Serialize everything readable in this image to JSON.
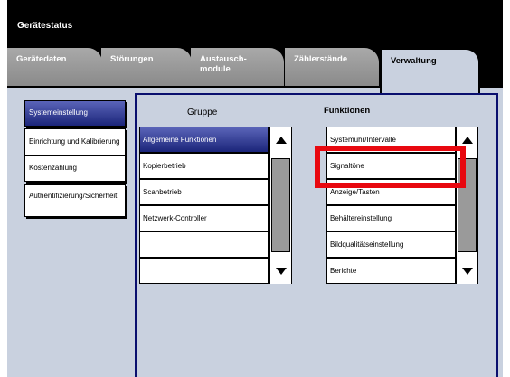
{
  "header": {
    "title": "Gerätestatus"
  },
  "tabs": [
    {
      "label": "Gerätedaten",
      "active": false
    },
    {
      "label": "Störungen",
      "active": false
    },
    {
      "label": "Austausch-\nmodule",
      "active": false
    },
    {
      "label": "Zählerstände",
      "active": false
    },
    {
      "label": "Verwaltung",
      "active": true
    }
  ],
  "sidebar": {
    "items": [
      {
        "label": "Systemeinstellung",
        "active": true
      },
      {
        "label": "Einrichtung und Kalibrierung",
        "active": false
      },
      {
        "label": "Kostenzählung",
        "active": false
      },
      {
        "label": "Authentifizierung/Sicherheit",
        "active": false
      }
    ]
  },
  "group": {
    "header": "Gruppe",
    "items": [
      "Allgemeine Funktionen",
      "Kopierbetrieb",
      "Scanbetrieb",
      "Netzwerk-Controller",
      "",
      ""
    ],
    "selected": 0
  },
  "functions": {
    "header": "Funktionen",
    "items": [
      "Systemuhr/Intervalle",
      "Signaltöne",
      "Anzeige/Tasten",
      "Behältereinstellung",
      "Bildqualitätseinstellung",
      "Berichte"
    ]
  },
  "icons": {
    "scroll_up": "arrow-up-icon",
    "scroll_down": "arrow-down-icon"
  },
  "colors": {
    "selected_start": "#5a64b8",
    "selected_end": "#1b257a",
    "highlight": "#e8080f",
    "background": "#c9d1df"
  }
}
